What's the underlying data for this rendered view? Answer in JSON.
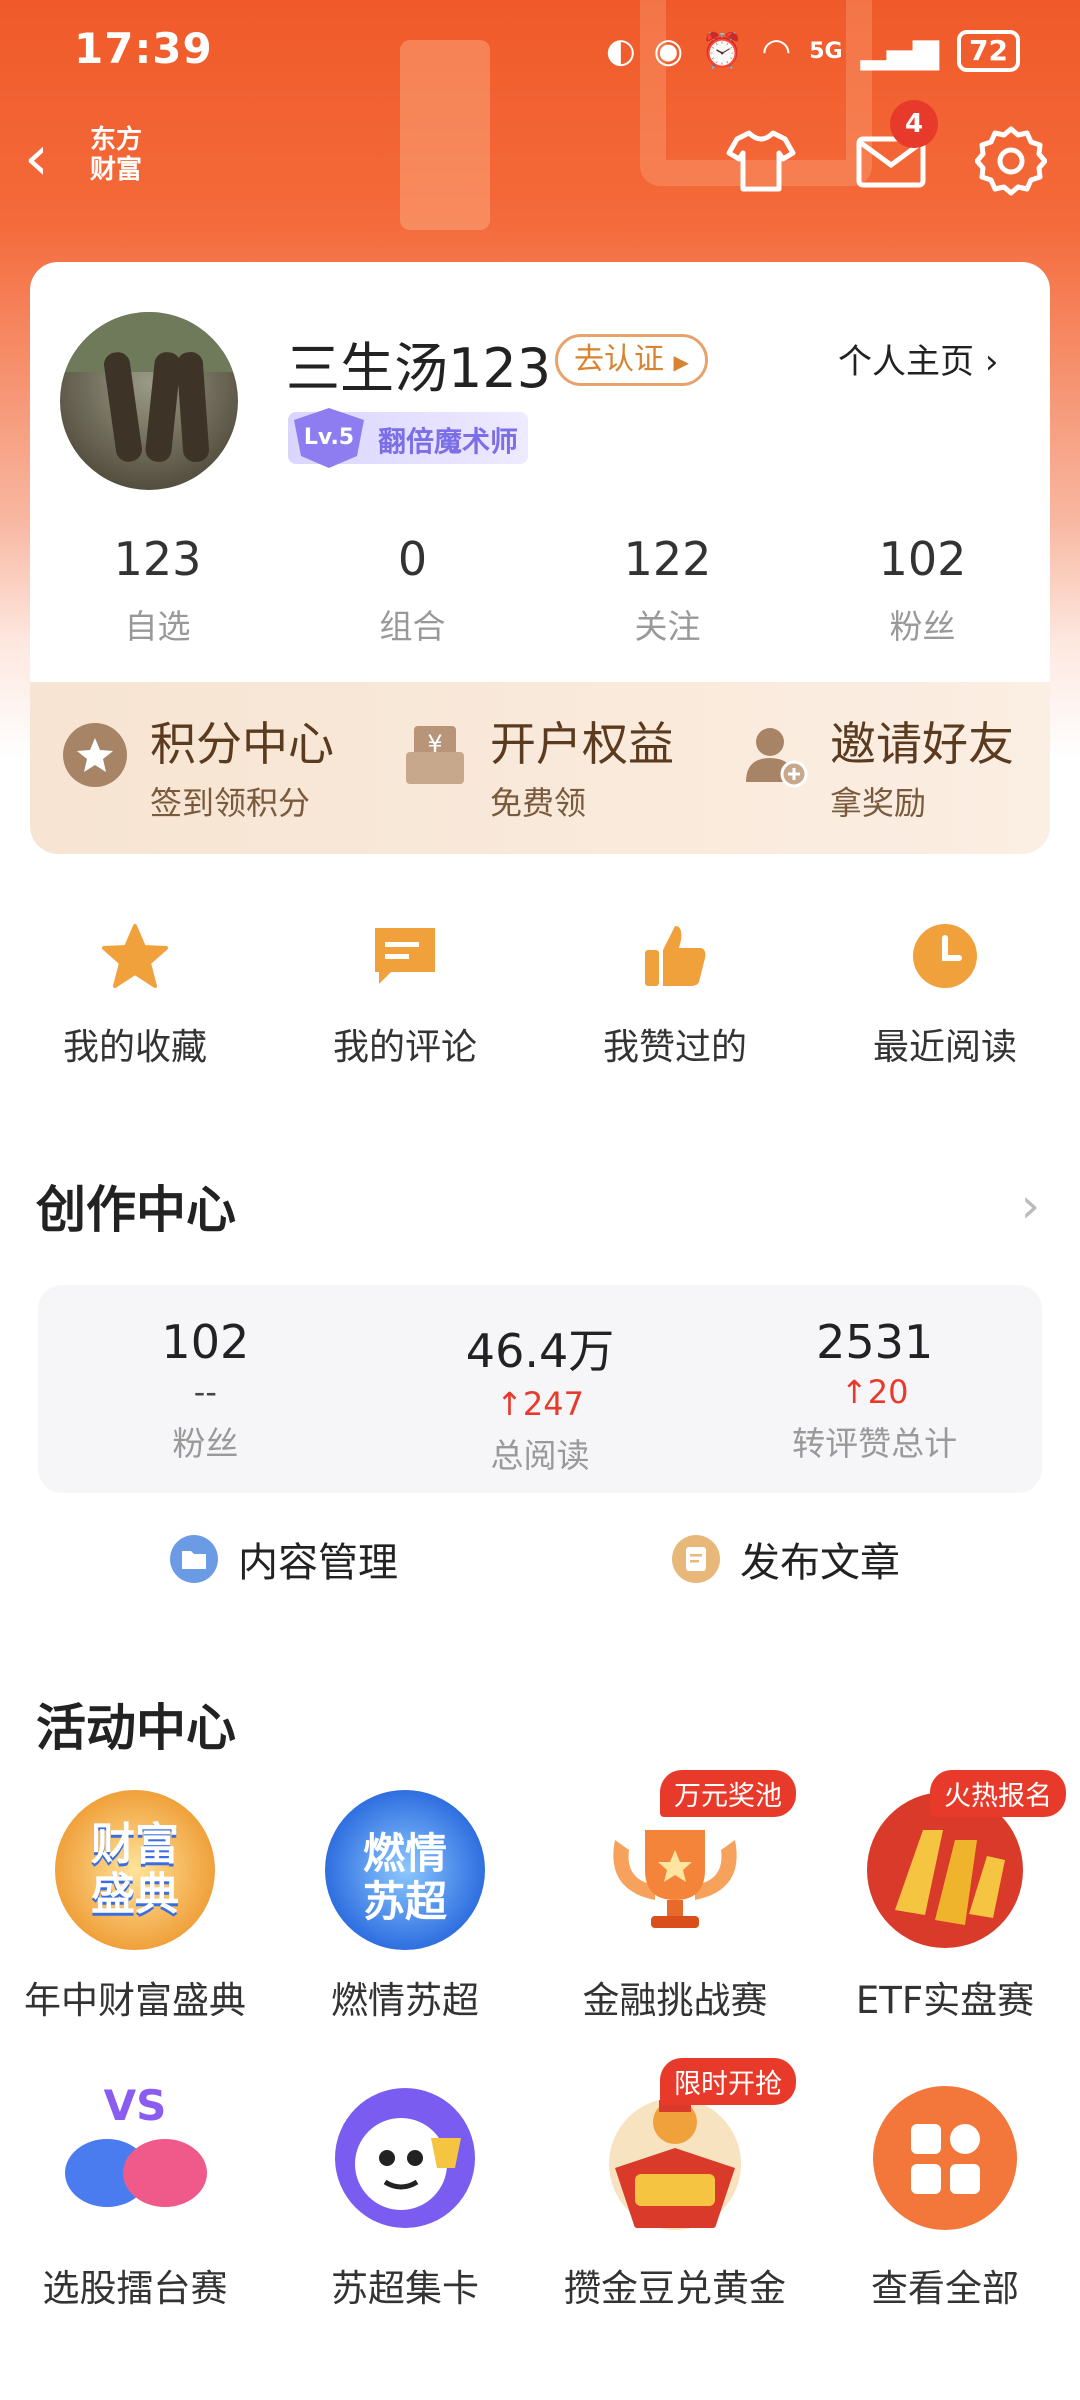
{
  "status_bar": {
    "time": "17:39",
    "network": "5G",
    "battery": "72"
  },
  "nav": {
    "logo_line1": "东方",
    "logo_line2": "财富",
    "message_badge": "4"
  },
  "profile": {
    "username": "三生汤123",
    "verify_label": "去认证",
    "level_badge": "Lv.5",
    "level_title": "翻倍魔术师",
    "homepage_link": "个人主页",
    "stats": [
      {
        "value": "123",
        "label": "自选"
      },
      {
        "value": "0",
        "label": "组合"
      },
      {
        "value": "122",
        "label": "关注"
      },
      {
        "value": "102",
        "label": "粉丝"
      }
    ]
  },
  "quick_actions": [
    {
      "title": "积分中心",
      "subtitle": "签到领积分",
      "icon": "points-star-icon"
    },
    {
      "title": "开户权益",
      "subtitle": "免费领",
      "icon": "yuan-box-icon"
    },
    {
      "title": "邀请好友",
      "subtitle": "拿奖励",
      "icon": "add-user-icon"
    }
  ],
  "shortcuts": [
    {
      "label": "我的收藏",
      "icon": "star-icon"
    },
    {
      "label": "我的评论",
      "icon": "comment-icon"
    },
    {
      "label": "我赞过的",
      "icon": "thumbs-up-icon"
    },
    {
      "label": "最近阅读",
      "icon": "clock-icon"
    }
  ],
  "creation_center": {
    "title": "创作中心",
    "stats": [
      {
        "value": "102",
        "delta": "--",
        "label": "粉丝"
      },
      {
        "value": "46.4万",
        "delta": "↑247",
        "label": "总阅读"
      },
      {
        "value": "2531",
        "delta": "↑20",
        "label": "转评赞总计"
      }
    ],
    "actions": [
      {
        "label": "内容管理",
        "icon": "folder-icon"
      },
      {
        "label": "发布文章",
        "icon": "document-icon"
      }
    ]
  },
  "activity_center": {
    "title": "活动中心",
    "items": [
      {
        "label": "年中财富盛典",
        "art_text": "财富盛典",
        "tag": ""
      },
      {
        "label": "燃情苏超",
        "art_text": "燃情苏超",
        "tag": ""
      },
      {
        "label": "金融挑战赛",
        "art_text": "",
        "tag": "万元奖池"
      },
      {
        "label": "ETF实盘赛",
        "art_text": "",
        "tag": "火热报名"
      },
      {
        "label": "选股擂台赛",
        "art_text": "VS",
        "tag": ""
      },
      {
        "label": "苏超集卡",
        "art_text": "",
        "tag": ""
      },
      {
        "label": "攒金豆兑黄金",
        "art_text": "",
        "tag": "限时开抢"
      },
      {
        "label": "查看全部",
        "art_text": "",
        "tag": ""
      }
    ]
  },
  "colors": {
    "brand": "#f05a2a",
    "accent_red": "#e83a2b",
    "gold": "#f0a13c"
  }
}
